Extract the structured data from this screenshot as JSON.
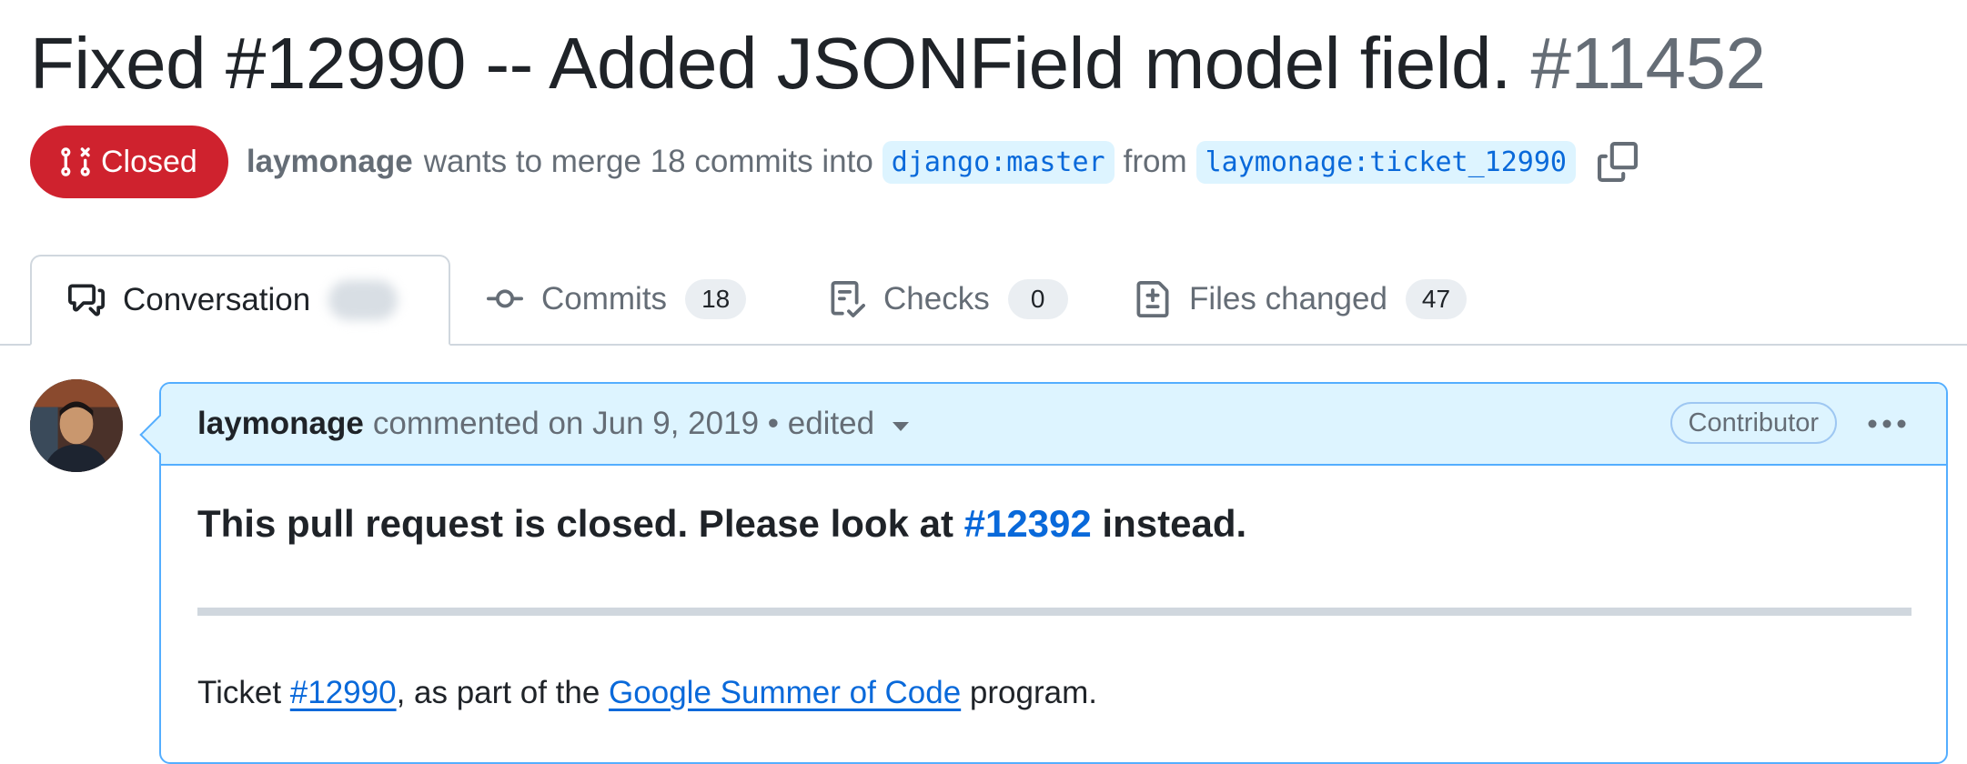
{
  "pr": {
    "title": "Fixed #12990 -- Added JSONField model field.",
    "number": "#11452",
    "state": "Closed",
    "author": "laymonage",
    "merge_text": "wants to merge 18 commits into",
    "base_branch": "django:master",
    "from_text": "from",
    "head_branch": "laymonage:ticket_12990"
  },
  "tabs": [
    {
      "label": "Conversation",
      "icon": "comment-discussion-icon",
      "count": ""
    },
    {
      "label": "Commits",
      "icon": "git-commit-icon",
      "count": "18"
    },
    {
      "label": "Checks",
      "icon": "checklist-icon",
      "count": "0"
    },
    {
      "label": "Files changed",
      "icon": "file-diff-icon",
      "count": "47"
    }
  ],
  "comment": {
    "author": "laymonage",
    "meta": "commented on Jun 9, 2019 • edited",
    "role": "Contributor",
    "headline_before": "This pull request is closed. Please look at ",
    "headline_link": "#12392",
    "headline_after": " instead.",
    "para_before": "Ticket ",
    "para_link1": "#12990",
    "para_mid": ", as part of the ",
    "para_link2": "Google Summer of Code",
    "para_after": " program."
  },
  "colors": {
    "closed": "#cf222e",
    "link": "#0969da",
    "comment_border": "#54aeff",
    "comment_header_bg": "#ddf4ff"
  }
}
